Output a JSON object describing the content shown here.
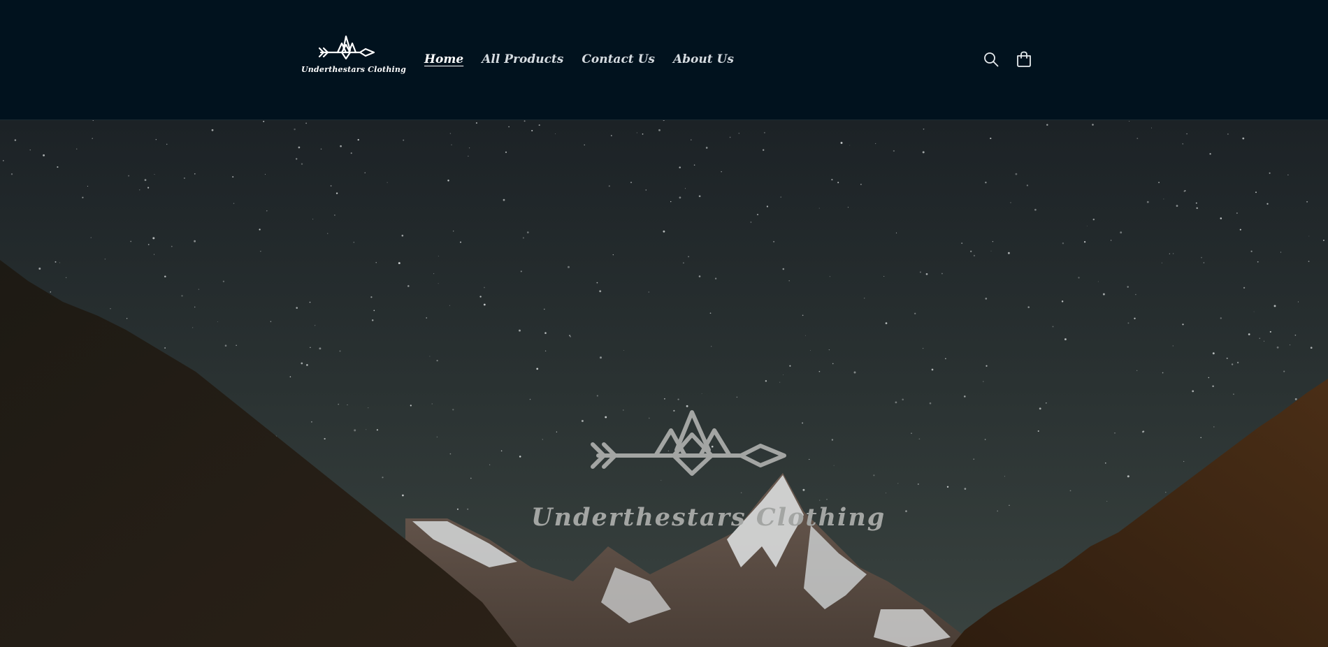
{
  "brand": {
    "name": "Underthestars Clothing",
    "logo_icon": "arrow-mountains-logo-icon"
  },
  "nav": {
    "items": [
      {
        "label": "Home",
        "active": true
      },
      {
        "label": "All Products",
        "active": false
      },
      {
        "label": "Contact Us",
        "active": false
      },
      {
        "label": "About Us",
        "active": false
      }
    ]
  },
  "header_icons": {
    "search": "search-icon",
    "cart": "cart-icon"
  },
  "hero": {
    "title": "Underthestars Clothing",
    "logo_icon": "arrow-mountains-logo-icon",
    "background": "starry-night-mountains-image"
  },
  "colors": {
    "header_bg": "#01121e",
    "nav_text": "#d5dbe0",
    "hero_logo": "#a3a5a3"
  }
}
